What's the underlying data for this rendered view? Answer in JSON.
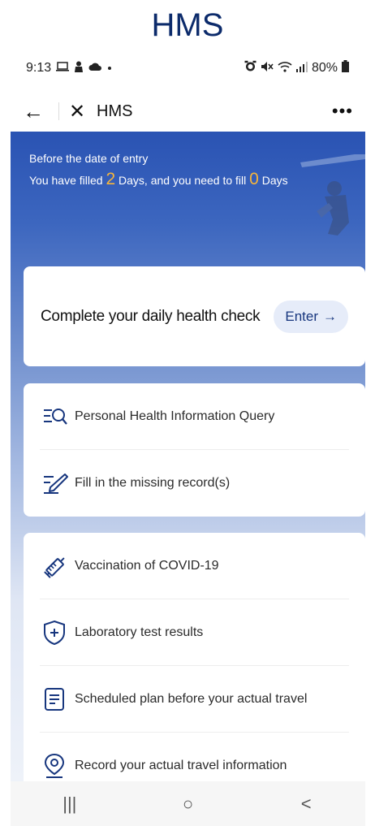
{
  "caption": "HMS",
  "status_bar": {
    "time": "9:13",
    "battery": "80%",
    "left_icons": [
      "laptop-icon",
      "person-icon",
      "cloud-icon",
      "dot-icon"
    ],
    "right_icons": [
      "alarm-icon",
      "mute-icon",
      "wifi-icon",
      "signal-icon",
      "battery-icon"
    ]
  },
  "nav": {
    "title": "HMS",
    "back_glyph": "←",
    "close_glyph": "✕",
    "more_glyph": "•••"
  },
  "banner": {
    "line1": "Before the date of entry",
    "line2_pre": "You have filled",
    "filled_days": "2",
    "line2_mid": "Days, and you need to fill",
    "need_days": "0",
    "line2_post": "Days"
  },
  "health_check": {
    "label": "Complete your daily health check",
    "button": "Enter",
    "button_arrow": "→"
  },
  "list1": [
    {
      "label": "Personal Health Information Query",
      "icon": "search-list-icon"
    },
    {
      "label": "Fill in the missing record(s)",
      "icon": "edit-pen-icon"
    }
  ],
  "list2": [
    {
      "label": "Vaccination of COVID-19",
      "icon": "syringe-icon"
    },
    {
      "label": "Laboratory test results",
      "icon": "shield-plus-icon"
    },
    {
      "label": "Scheduled plan before your actual travel",
      "icon": "document-icon"
    },
    {
      "label": "Record your actual travel information",
      "icon": "location-pin-icon"
    }
  ],
  "system_nav": {
    "recent": "|||",
    "home": "○",
    "back": "<"
  },
  "colors": {
    "accent": "#17367e",
    "highlight": "#f6b53b",
    "banner_top": "#2a53b3",
    "caption": "#0c2b6b"
  }
}
